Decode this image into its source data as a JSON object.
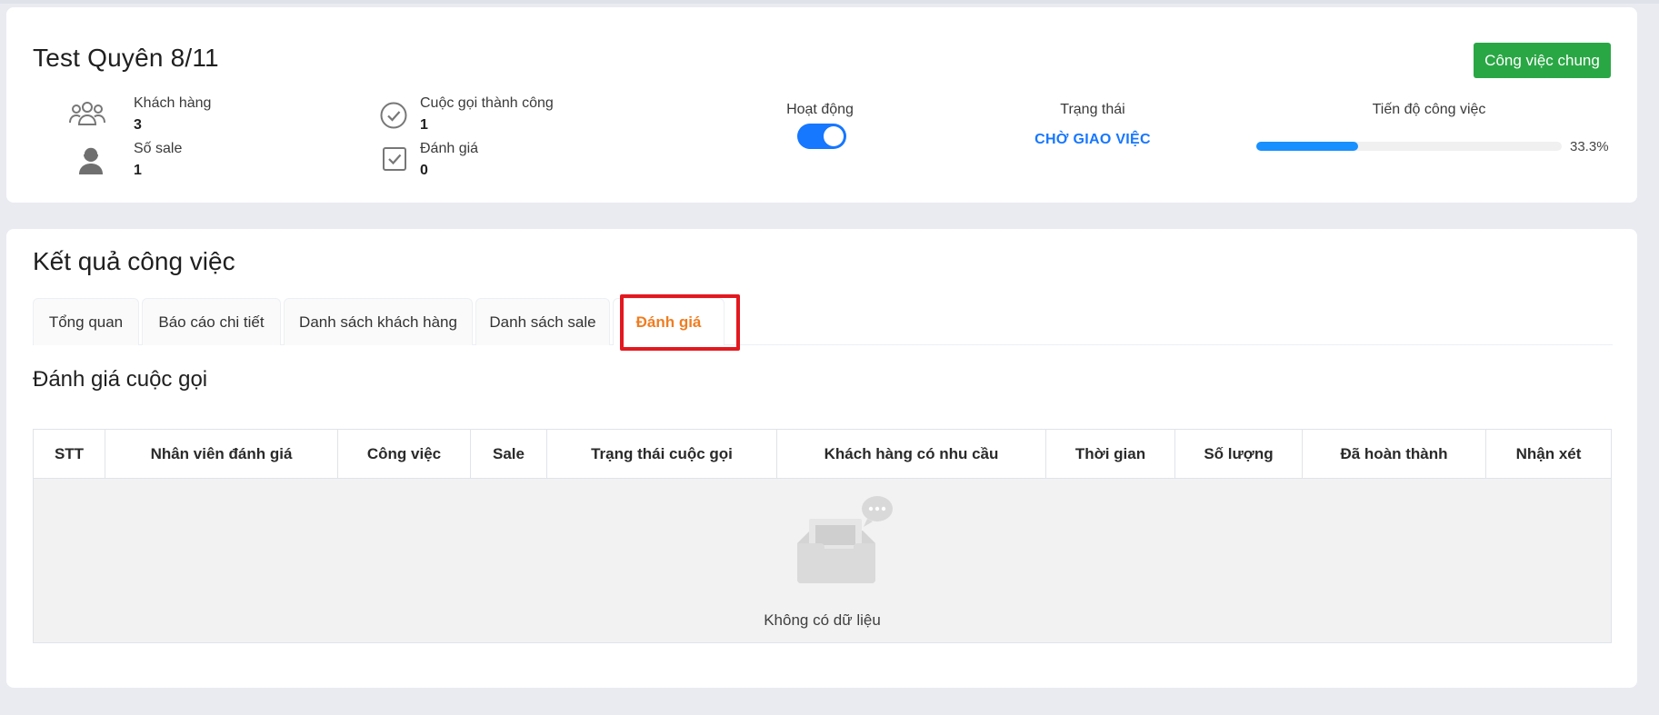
{
  "project": {
    "title": "Test Quyên 8/11",
    "general_button": "Công việc chung"
  },
  "stats": {
    "customers": {
      "label": "Khách hàng",
      "value": "3"
    },
    "sales": {
      "label": "Số sale",
      "value": "1"
    },
    "successful_calls": {
      "label": "Cuộc gọi thành công",
      "value": "1"
    },
    "reviews": {
      "label": "Đánh giá",
      "value": "0"
    },
    "activity": {
      "label": "Hoạt động",
      "on": true
    },
    "status": {
      "label": "Trạng thái",
      "value": "CHỜ GIAO VIỆC"
    },
    "progress": {
      "label": "Tiến độ công việc",
      "value": "33.3%",
      "fraction": 0.333
    }
  },
  "results": {
    "title": "Kết quả công việc",
    "tabs": [
      "Tổng quan",
      "Báo cáo chi tiết",
      "Danh sách khách hàng",
      "Danh sách sale",
      "Đánh giá"
    ],
    "active_tab": "Đánh giá"
  },
  "reviews_section": {
    "title": "Đánh giá cuộc gọi",
    "columns": [
      "STT",
      "Nhân viên đánh giá",
      "Công việc",
      "Sale",
      "Trạng thái cuộc gọi",
      "Khách hàng có nhu cầu",
      "Thời gian",
      "Số lượng",
      "Đã hoàn thành",
      "Nhận xét"
    ],
    "empty_text": "Không có dữ liệu"
  },
  "colors": {
    "accent": "#1677ff",
    "success": "#2aa745",
    "active_tab": "#ef7d22",
    "highlight": "#e3181f"
  }
}
